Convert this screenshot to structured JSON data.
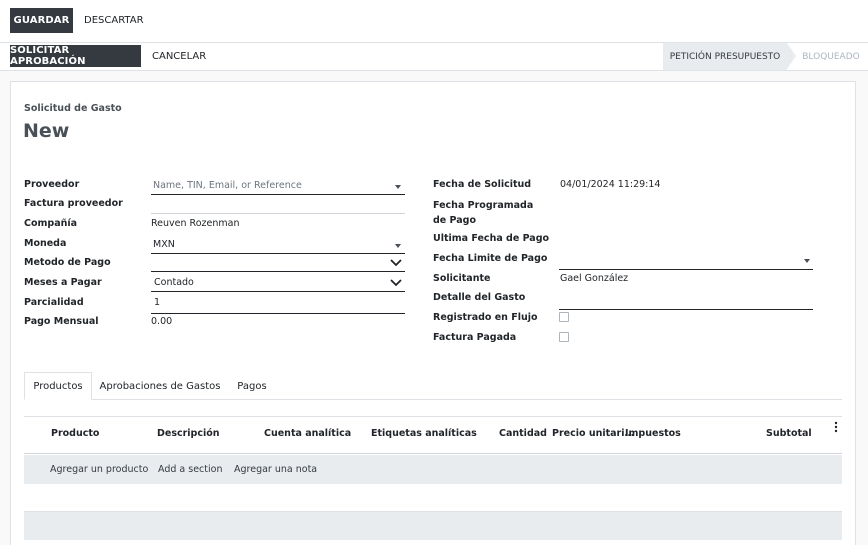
{
  "toolbar": {
    "save_label": "GUARDAR",
    "discard_label": "DESCARTAR"
  },
  "actions": {
    "request_approval_label": "SOLICITAR APROBACIÓN",
    "cancel_label": "CANCELAR"
  },
  "statusbar": {
    "stages": [
      "PETICIÓN PRESUPUESTO",
      "BLOQUEADO"
    ],
    "active_stage": "PETICIÓN PRESUPUESTO"
  },
  "form": {
    "subtitle": "Solicitud de Gasto",
    "title": "New",
    "left": {
      "proveedor_label": "Proveedor",
      "proveedor_placeholder": "Name, TIN, Email, or Reference",
      "factura_label": "Factura proveedor",
      "compania_label": "Compañía",
      "compania_value": "Reuven Rozenman",
      "moneda_label": "Moneda",
      "moneda_value": "MXN",
      "metodo_label": "Metodo de Pago",
      "metodo_value": "",
      "meses_label": "Meses a Pagar",
      "meses_value": "Contado",
      "parcialidad_label": "Parcialidad",
      "parcialidad_value": "1",
      "pago_label": "Pago Mensual",
      "pago_value": "0.00"
    },
    "right": {
      "fecha_solicitud_label": "Fecha de Solicitud",
      "fecha_solicitud_value": "04/01/2024 11:29:14",
      "fecha_programada_label": "Fecha Programada de Pago",
      "ultima_label": "Ultima Fecha de Pago",
      "limite_label": "Fecha Limite de Pago",
      "solicitante_label": "Solicitante",
      "solicitante_value": "Gael González",
      "detalle_label": "Detalle del Gasto",
      "registrado_label": "Registrado en Flujo",
      "registrado_checked": false,
      "pagada_label": "Factura Pagada",
      "pagada_checked": false
    }
  },
  "tabs": [
    {
      "label": "Productos",
      "active": true
    },
    {
      "label": "Aprobaciones de Gastos",
      "active": false
    },
    {
      "label": "Pagos",
      "active": false
    }
  ],
  "table": {
    "columns": [
      "Producto",
      "Descripción",
      "Cuenta analítica",
      "Etiquetas analíticas",
      "Cantidad",
      "Precio unitari…",
      "Impuestos",
      "Subtotal"
    ],
    "row_actions": [
      "Agregar un producto",
      "Add a section",
      "Agregar una nota"
    ]
  },
  "icons": {
    "kebab": "vertical-dots-icon",
    "dropdown": "caret-down-icon",
    "select": "chevron-down-icon"
  },
  "colors": {
    "primary_dark": "#343a40",
    "active_stage_bg": "#e9ecef",
    "row_bg": "#e9ecef"
  }
}
